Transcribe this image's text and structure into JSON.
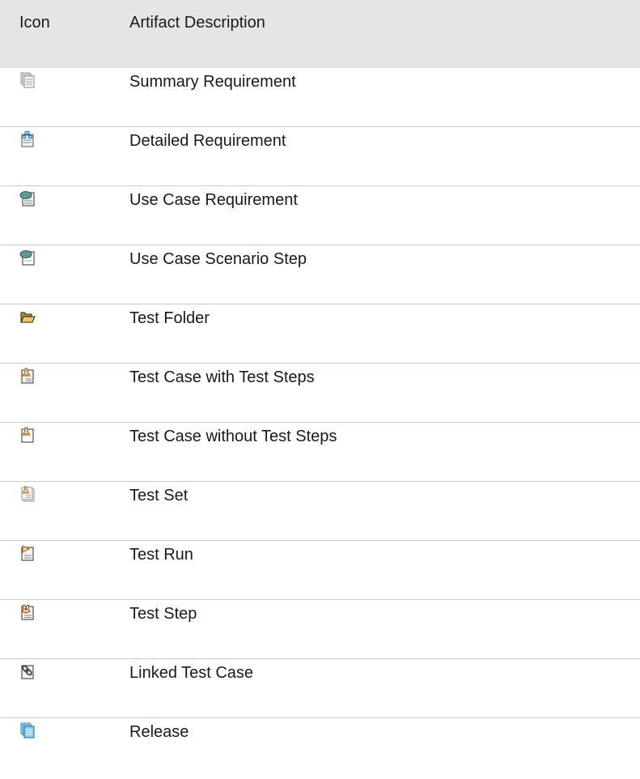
{
  "header": {
    "icon_label": "Icon",
    "description_label": "Artifact Description"
  },
  "rows": [
    {
      "icon": "summary-requirement-icon",
      "label": "Summary Requirement"
    },
    {
      "icon": "detailed-requirement-icon",
      "label": "Detailed Requirement"
    },
    {
      "icon": "use-case-requirement-icon",
      "label": "Use Case Requirement"
    },
    {
      "icon": "use-case-scenario-step-icon",
      "label": "Use Case Scenario Step"
    },
    {
      "icon": "test-folder-icon",
      "label": "Test Folder"
    },
    {
      "icon": "test-case-with-steps-icon",
      "label": "Test Case with Test Steps"
    },
    {
      "icon": "test-case-without-steps-icon",
      "label": "Test Case without Test Steps"
    },
    {
      "icon": "test-set-icon",
      "label": "Test Set"
    },
    {
      "icon": "test-run-icon",
      "label": "Test Run"
    },
    {
      "icon": "test-step-icon",
      "label": "Test Step"
    },
    {
      "icon": "linked-test-case-icon",
      "label": "Linked Test Case"
    },
    {
      "icon": "release-icon",
      "label": "Release"
    }
  ],
  "colors": {
    "header_bg": "#e5e5e5",
    "row_border": "#cccccc",
    "text": "#1a1a1a"
  }
}
